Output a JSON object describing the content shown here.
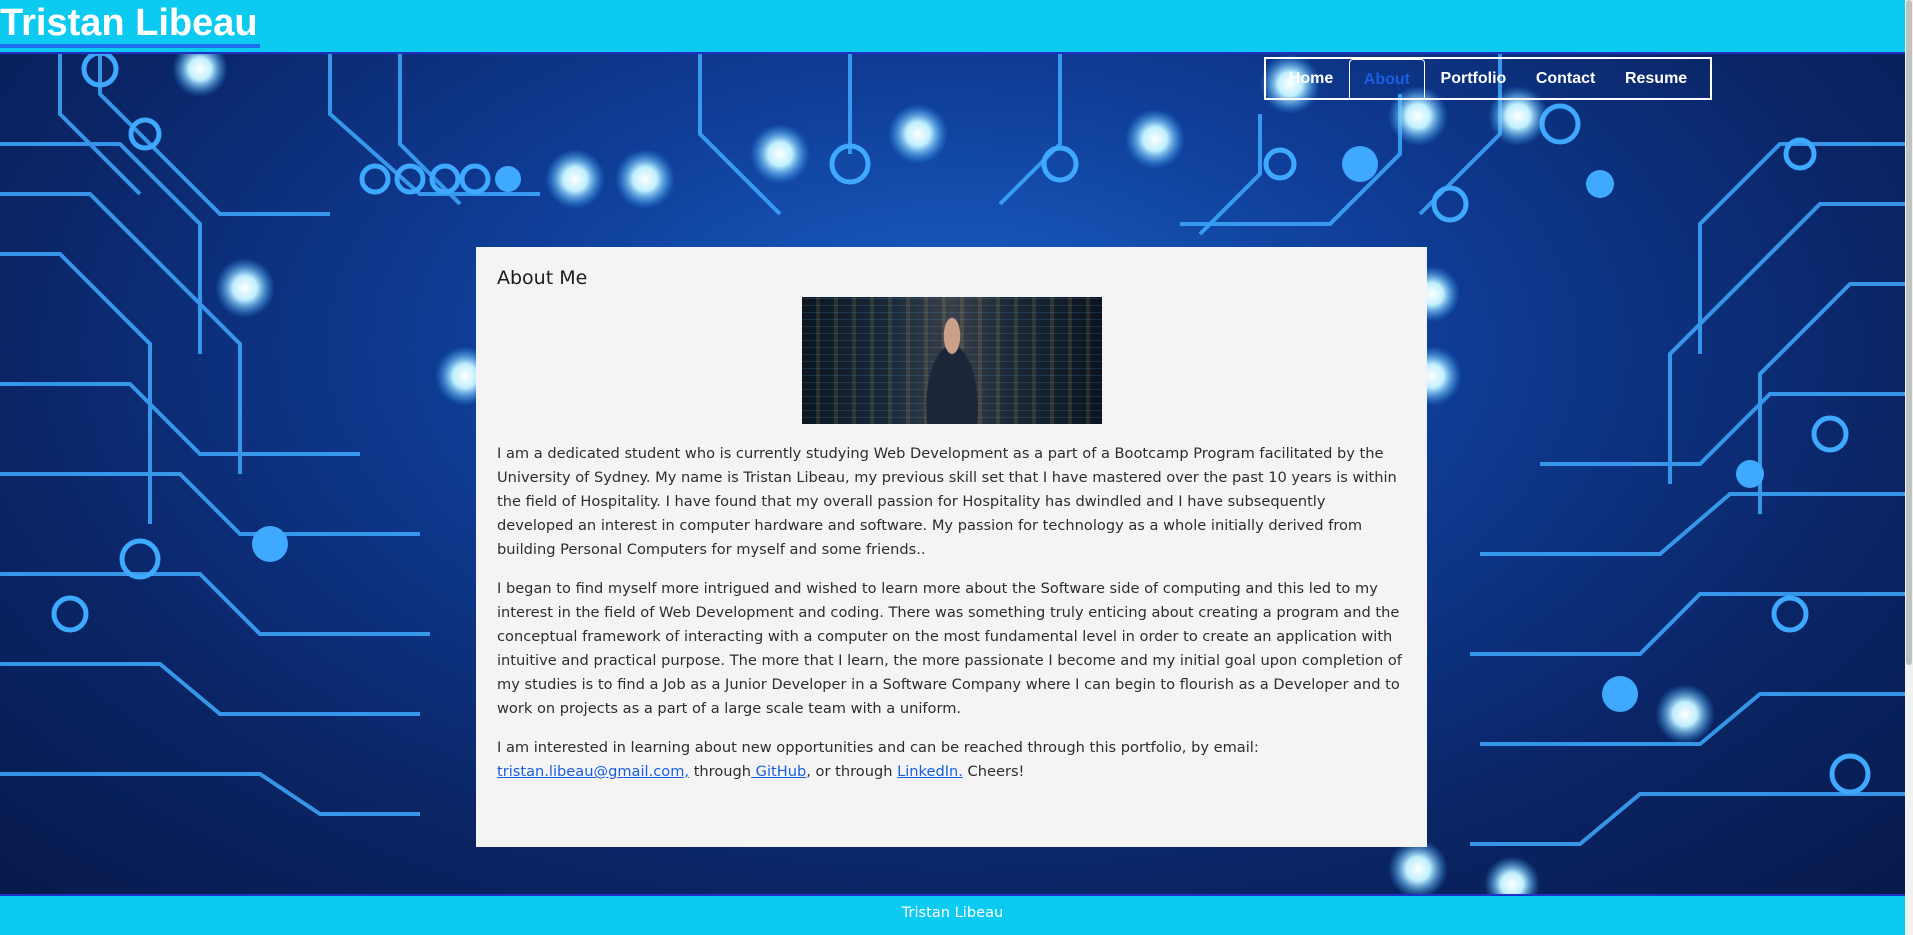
{
  "header": {
    "title": "Tristan Libeau"
  },
  "nav": {
    "items": [
      {
        "label": "Home"
      },
      {
        "label": "About"
      },
      {
        "label": "Portfolio"
      },
      {
        "label": "Contact"
      },
      {
        "label": "Resume"
      }
    ],
    "active": "About"
  },
  "about": {
    "heading": "About Me",
    "paragraph1": "I am a dedicated student who is currently studying Web Development as a part of a Bootcamp Program facilitated by the University of Sydney. My name is Tristan Libeau, my previous skill set that I have mastered over the past 10 years is within the field of Hospitality. I have found that my overall passion for Hospitality has dwindled and I have subsequently developed an interest in computer hardware and software. My passion for technology as a whole initially derived from building Personal Computers for myself and some friends..",
    "paragraph2": "I began to find myself more intrigued and wished to learn more about the Software side of computing and this led to my interest in the field of Web Development and coding. There was something truly enticing about creating a program and the conceptual framework of interacting with a computer on the most fundamental level in order to create an application with intuitive and practical purpose. The more that I learn, the more passionate I become and my initial goal upon completion of my studies is to find a Job as a Junior Developer in a Software Company where I can begin to flourish as a Developer and to work on projects as a part of a large scale team with a uniform.",
    "contact_intro": "I am interested in learning about new opportunities and can be reached through this portfolio, by email:",
    "email_link": "tristan.libeau@gmail.com,",
    "through1": " through",
    "github_link": " GitHub",
    "through2": ", or through ",
    "linkedin_link": "LinkedIn.",
    "cheers": " Cheers!"
  },
  "footer": {
    "text": "Tristan Libeau"
  },
  "colors": {
    "header_bg": "#0ccaf0",
    "accent_border": "#1f30c9",
    "link": "#1a5ee0",
    "card_bg": "#f4f4f4"
  }
}
